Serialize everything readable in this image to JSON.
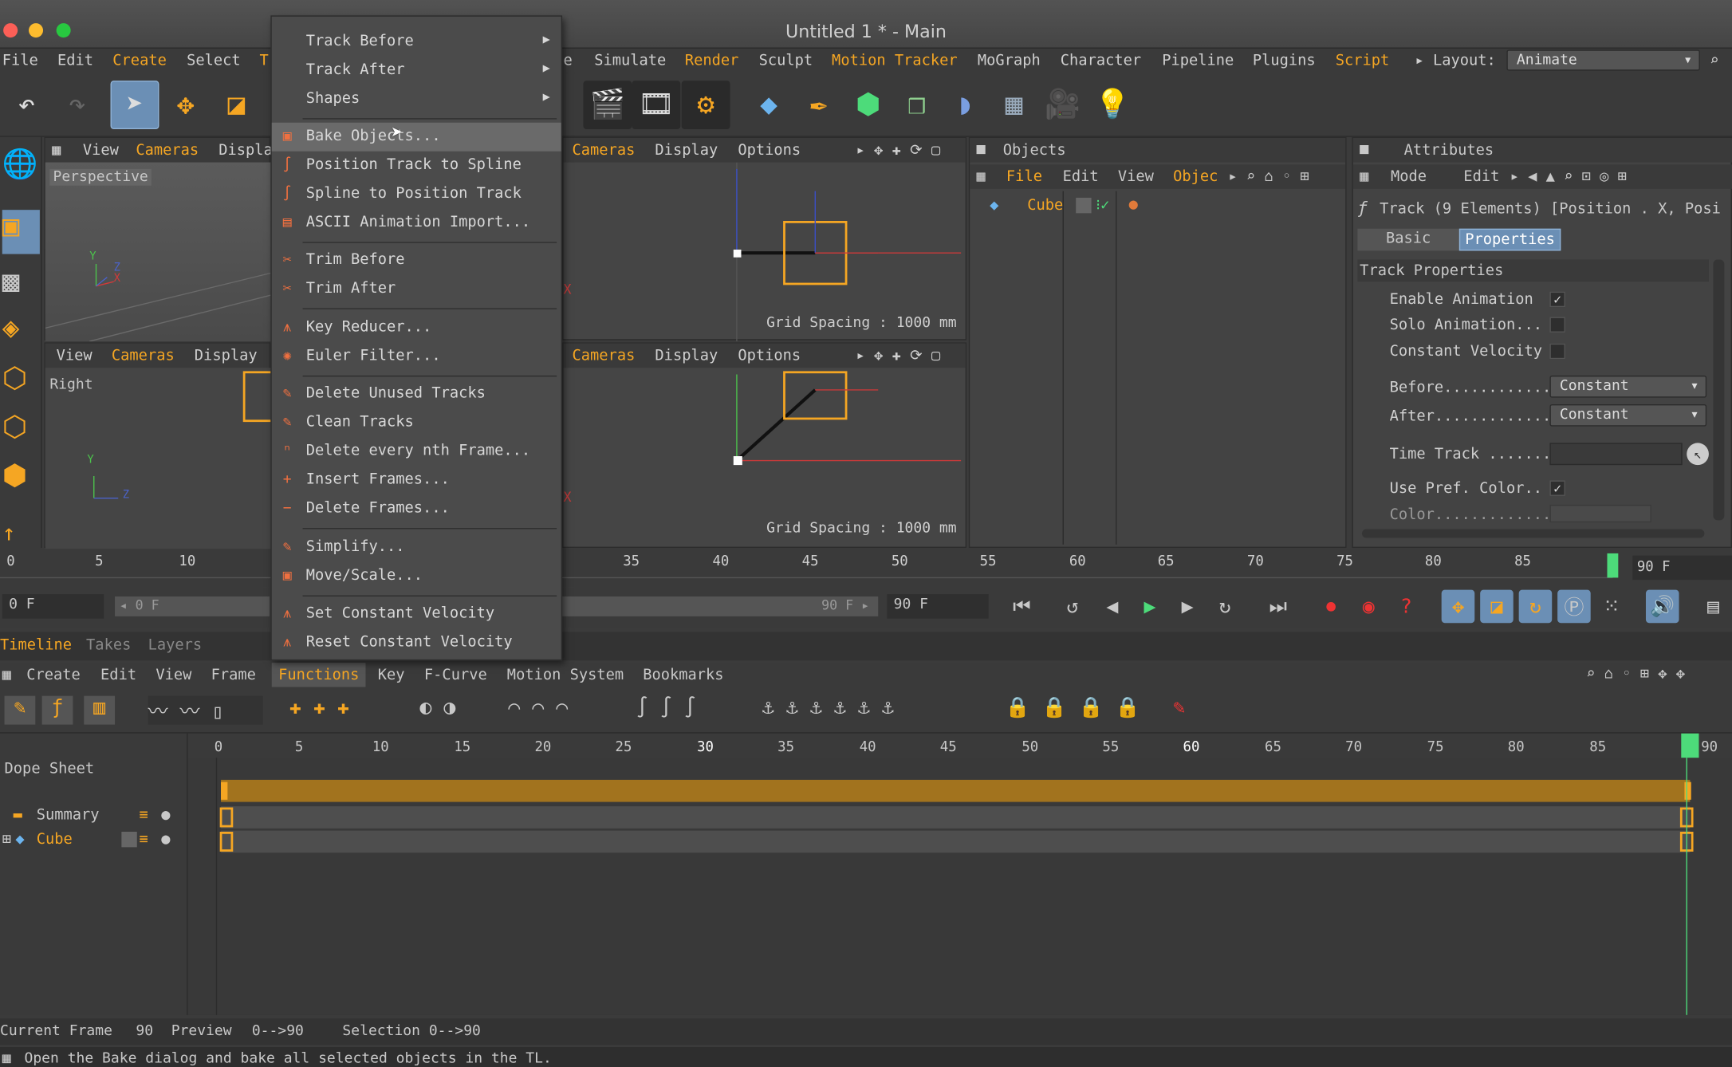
{
  "window": {
    "title": "Untitled 1 * - Main"
  },
  "menubar": {
    "items": [
      "File",
      "Edit",
      "Create",
      "Select",
      "T",
      "e",
      "Simulate",
      "Render",
      "Sculpt",
      "Motion Tracker",
      "MoGraph",
      "Character",
      "Pipeline",
      "Plugins",
      "Script"
    ],
    "layout_label": "Layout:",
    "layout_value": "Animate"
  },
  "viewports": {
    "tl": {
      "menu": [
        "View",
        "Cameras",
        "Displa"
      ],
      "name": "Perspective"
    },
    "tr": {
      "menu": [
        "Cameras",
        "Display",
        "Options"
      ],
      "grid": "Grid Spacing : 1000 mm"
    },
    "bl": {
      "menu": [
        "View",
        "Cameras",
        "Display"
      ],
      "name": "Right"
    },
    "br": {
      "menu": [
        "Cameras",
        "Display",
        "Options"
      ],
      "grid": "Grid Spacing : 1000 mm"
    },
    "axis_x": "X",
    "axis_y": "Y",
    "axis_z": "Z"
  },
  "objects": {
    "title": "Objects",
    "menu": [
      "File",
      "Edit",
      "View",
      "Objec"
    ],
    "cube": "Cube"
  },
  "attributes": {
    "title": "Attributes",
    "menu": [
      "Mode",
      "Edit"
    ],
    "track": "Track (9 Elements) [Position . X, Posi",
    "tabs": [
      "Basic",
      "Properties"
    ],
    "section": "Track Properties",
    "enable_animation": "Enable Animation",
    "solo_animation": "Solo Animation...",
    "constant_velocity": "Constant Velocity",
    "before_label": "Before............",
    "before_value": "Constant",
    "after_label": "After.............",
    "after_value": "Constant",
    "time_track": "Time Track .......",
    "use_pref_color": "Use Pref. Color..",
    "color": "Color.............",
    "check": "✓"
  },
  "context_menu": {
    "items": [
      "Track Before",
      "Track After",
      "Shapes",
      "Bake Objects...",
      "Position Track to Spline",
      "Spline to Position Track",
      "ASCII Animation Import...",
      "Trim Before",
      "Trim After",
      "Key Reducer...",
      "Euler Filter...",
      "Delete Unused Tracks",
      "Clean Tracks",
      "Delete every nth Frame...",
      "Insert Frames...",
      "Delete Frames...",
      "Simplify...",
      "Move/Scale...",
      "Set Constant Velocity",
      "Reset Constant Velocity"
    ]
  },
  "timeline": {
    "ruler": [
      "0",
      "5",
      "10",
      "35",
      "40",
      "45",
      "50",
      "55",
      "60",
      "65",
      "70",
      "75",
      "80",
      "85"
    ],
    "end_frame": "90 F",
    "start_field": "0 F",
    "range_start": "◂ 0 F",
    "range_end": "90 F ▸",
    "end_field": "90 F"
  },
  "bottom_tabs": [
    "Timeline",
    "Takes",
    "Layers"
  ],
  "tl_menu": [
    "Create",
    "Edit",
    "View",
    "Frame",
    "Functions",
    "Key",
    "F-Curve",
    "Motion System",
    "Bookmarks"
  ],
  "dopesheet": {
    "label": "Dope Sheet",
    "summary": "Summary",
    "cube": "Cube",
    "ruler": [
      "0",
      "5",
      "10",
      "15",
      "20",
      "25",
      "30",
      "35",
      "40",
      "45",
      "50",
      "55",
      "60",
      "65",
      "70",
      "75",
      "80",
      "85",
      "90"
    ]
  },
  "status": {
    "current_frame": "Current Frame",
    "current_value": "90",
    "preview": "Preview",
    "preview_value": "0-->90",
    "selection": "Selection 0-->90",
    "hint": "Open the Bake dialog and bake all selected objects in the TL."
  }
}
